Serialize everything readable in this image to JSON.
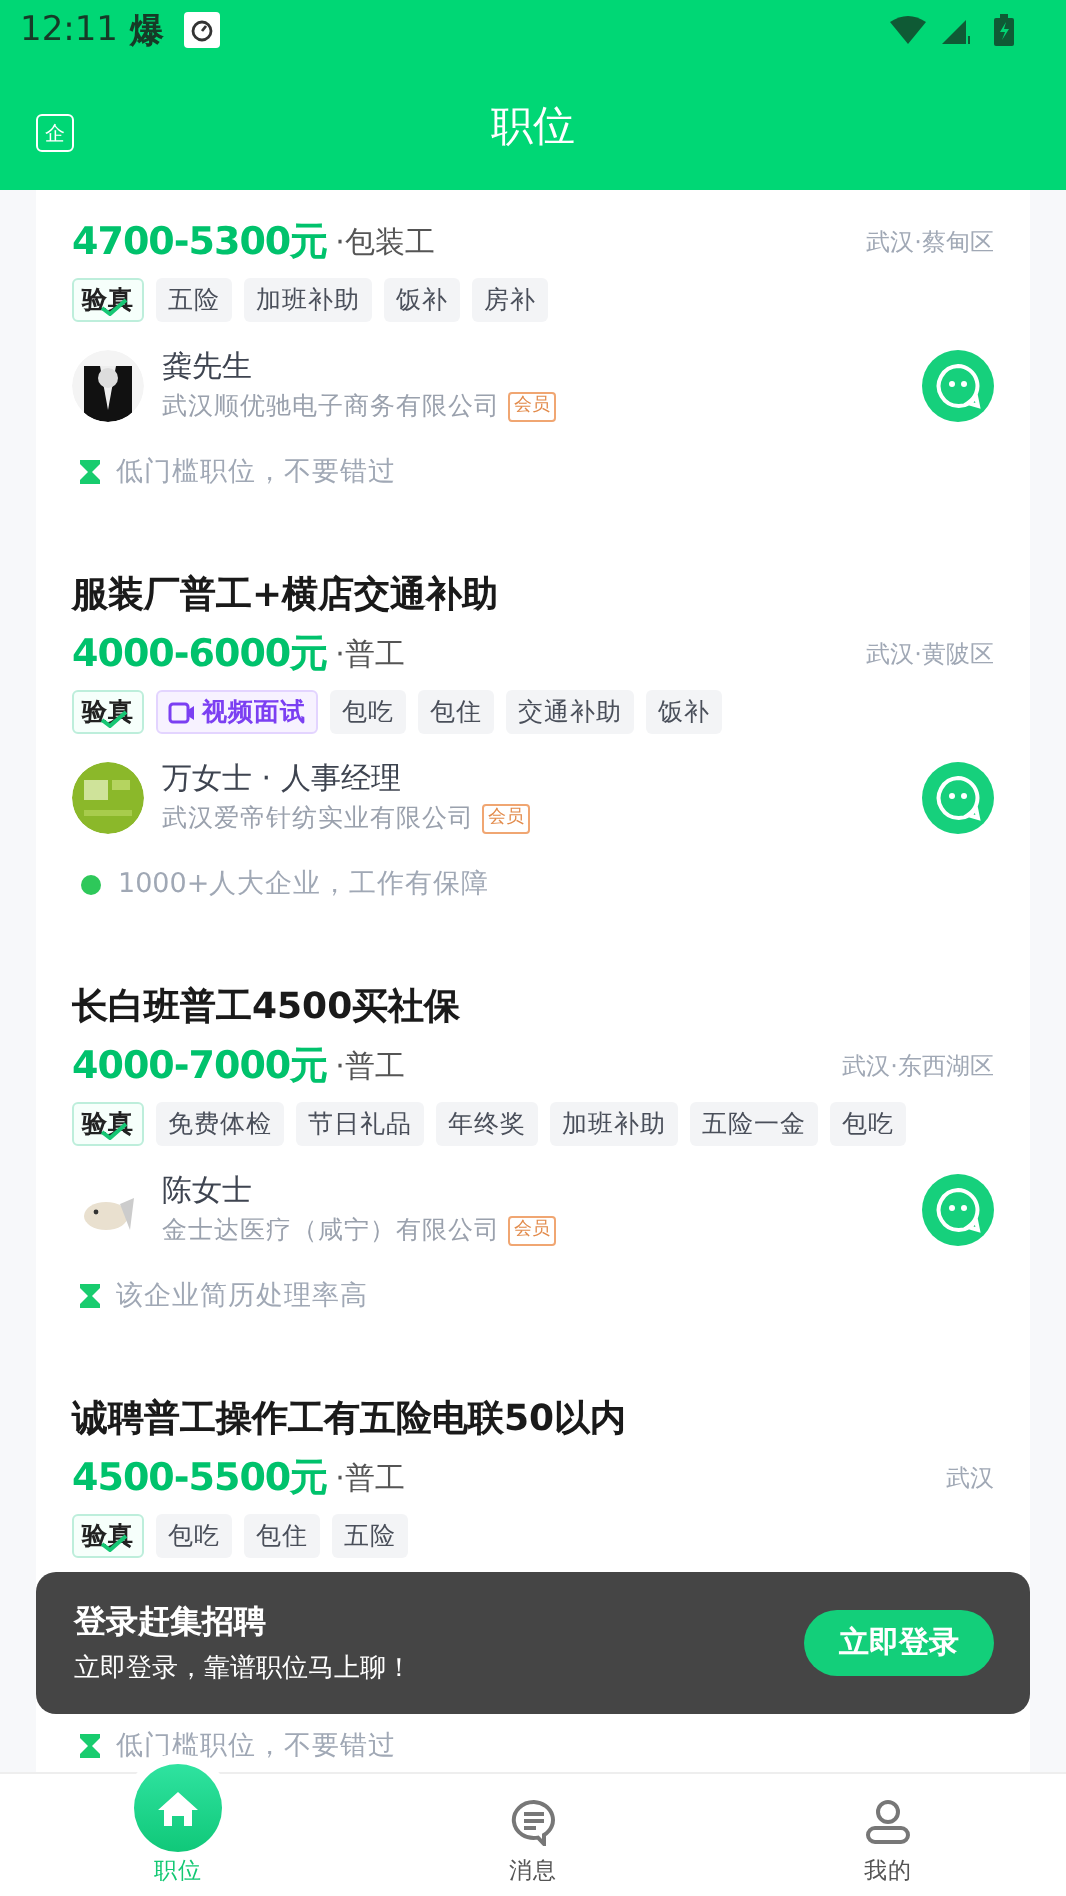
{
  "status_bar": {
    "time": "12:11",
    "notification_glyph": "爆"
  },
  "header": {
    "title": "职位",
    "left_button": "企"
  },
  "jobs": [
    {
      "salary": "4700-5300元",
      "category": "·包装工",
      "location": "武汉·蔡甸区",
      "tags": [
        {
          "kind": "verified",
          "label": "验真"
        },
        {
          "kind": "plain",
          "label": "五险"
        },
        {
          "kind": "plain",
          "label": "加班补助"
        },
        {
          "kind": "plain",
          "label": "饭补"
        },
        {
          "kind": "plain",
          "label": "房补"
        }
      ],
      "recruiter": "龚先生",
      "company": "武汉顺优驰电子商务有限公司",
      "member_badge": "会员",
      "hint": {
        "kind": "hourglass",
        "text": "低门槛职位，不要错过"
      }
    },
    {
      "title": "服装厂普工+横店交通补助",
      "salary": "4000-6000元",
      "category": "·普工",
      "location": "武汉·黄陂区",
      "tags": [
        {
          "kind": "verified",
          "label": "验真"
        },
        {
          "kind": "video",
          "label": "视频面试"
        },
        {
          "kind": "plain",
          "label": "包吃"
        },
        {
          "kind": "plain",
          "label": "包住"
        },
        {
          "kind": "plain",
          "label": "交通补助"
        },
        {
          "kind": "plain",
          "label": "饭补"
        }
      ],
      "recruiter": "万女士 · 人事经理",
      "company": "武汉爱帝针纺实业有限公司",
      "member_badge": "会员",
      "hint": {
        "kind": "dot",
        "text": "1000+人大企业，工作有保障"
      }
    },
    {
      "title": "长白班普工4500买社保",
      "salary": "4000-7000元",
      "category": "·普工",
      "location": "武汉·东西湖区",
      "tags": [
        {
          "kind": "verified",
          "label": "验真"
        },
        {
          "kind": "plain",
          "label": "免费体检"
        },
        {
          "kind": "plain",
          "label": "节日礼品"
        },
        {
          "kind": "plain",
          "label": "年终奖"
        },
        {
          "kind": "plain",
          "label": "加班补助"
        },
        {
          "kind": "plain",
          "label": "五险一金"
        },
        {
          "kind": "plain",
          "label": "包吃"
        }
      ],
      "recruiter": "陈女士",
      "company": "金士达医疗（咸宁）有限公司",
      "member_badge": "会员",
      "hint": {
        "kind": "hourglass",
        "text": "该企业简历处理率高"
      }
    },
    {
      "title": "诚聘普工操作工有五险电联50以内",
      "salary": "4500-5500元",
      "category": "·普工",
      "location": "武汉",
      "tags": [
        {
          "kind": "verified",
          "label": "验真"
        },
        {
          "kind": "plain",
          "label": "包吃"
        },
        {
          "kind": "plain",
          "label": "包住"
        },
        {
          "kind": "plain",
          "label": "五险"
        }
      ],
      "hint": {
        "kind": "hourglass",
        "text": "低门槛职位，不要错过"
      }
    }
  ],
  "login_toast": {
    "title": "登录赶集招聘",
    "subtitle": "立即登录，靠谱职位马上聊！",
    "button": "立即登录"
  },
  "bottom_nav": [
    {
      "kind": "home",
      "label": "职位",
      "selected": true
    },
    {
      "kind": "message",
      "label": "消息",
      "selected": false
    },
    {
      "kind": "user",
      "label": "我的",
      "selected": false
    }
  ]
}
